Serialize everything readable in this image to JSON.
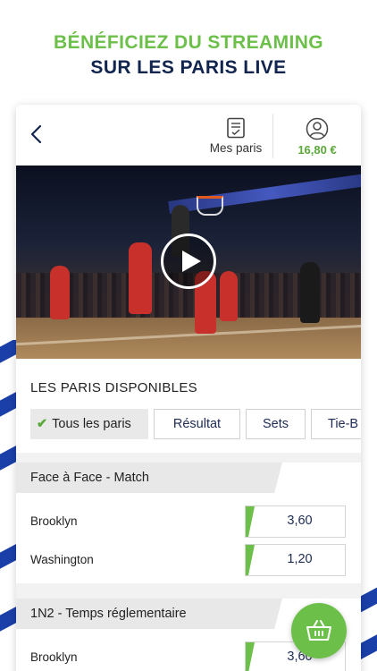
{
  "promo": {
    "line1": "BÉNÉFICIEZ DU STREAMING",
    "line2": "SUR LES PARIS LIVE"
  },
  "colors": {
    "accent_green": "#6cc04a",
    "navy": "#12254f",
    "stripe_blue": "#1b3fa8"
  },
  "topbar": {
    "back_icon": "chevron-left-icon",
    "mes_paris_label": "Mes paris",
    "mes_paris_icon": "bet-slip-icon",
    "account_icon": "user-circle-icon",
    "balance": "16,80 €"
  },
  "video": {
    "play_icon": "play-icon"
  },
  "bets": {
    "title": "LES PARIS DISPONIBLES",
    "filters": [
      {
        "label": "Tous les paris",
        "active": true
      },
      {
        "label": "Résultat",
        "active": false
      },
      {
        "label": "Sets",
        "active": false
      },
      {
        "label": "Tie-B",
        "active": false
      }
    ]
  },
  "markets": [
    {
      "title": "Face à Face - Match",
      "rows": [
        {
          "team": "Brooklyn",
          "odd": "3,60"
        },
        {
          "team": "Washington",
          "odd": "1,20"
        }
      ]
    },
    {
      "title": "1N2 - Temps réglementaire",
      "rows": [
        {
          "team": "Brooklyn",
          "odd": "3,60"
        }
      ]
    }
  ],
  "basket": {
    "icon": "basket-icon"
  }
}
